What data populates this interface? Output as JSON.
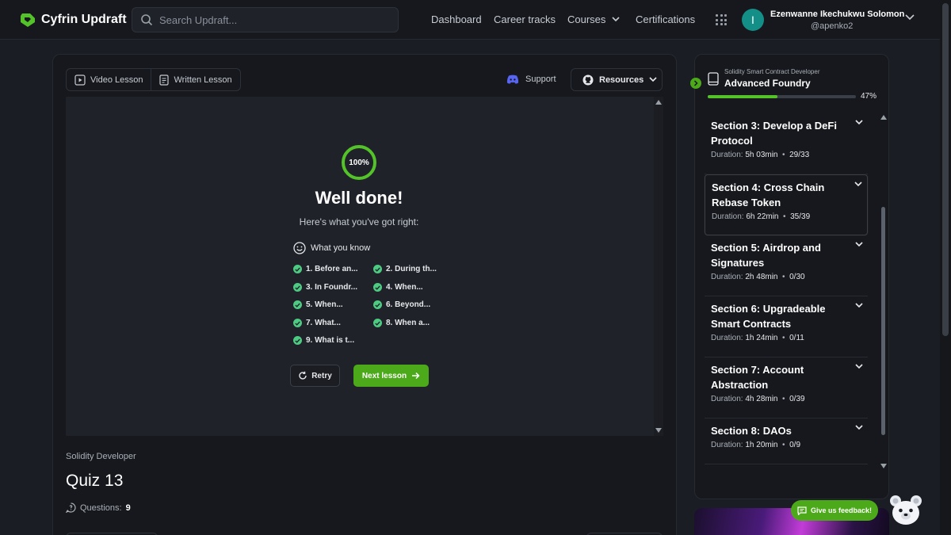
{
  "brand": {
    "name": "Cyfrin Updraft",
    "color": "#54c32a"
  },
  "search": {
    "placeholder": "Search Updraft..."
  },
  "nav": {
    "dashboard": "Dashboard",
    "career_tracks": "Career tracks",
    "courses": "Courses",
    "certifications": "Certifications"
  },
  "user": {
    "initial": "I",
    "name": "Ezenwanne Ikechukwu Solomon",
    "handle": "@apenko2"
  },
  "lesson_tabs": {
    "video": "Video Lesson",
    "written": "Written Lesson"
  },
  "support_label": "Support",
  "resources_label": "Resources",
  "quiz": {
    "score": "100%",
    "headline": "Well done!",
    "subtitle": "Here's what you've got right:",
    "know_title": "What you know",
    "answers": [
      "1. Before an...",
      "2. During th...",
      "3. In Foundr...",
      "4. When...",
      "5. When...",
      "6. Beyond...",
      "7. What...",
      "8. When a...",
      "9. What is t..."
    ],
    "retry_label": "Retry",
    "next_label": "Next lesson"
  },
  "lesson": {
    "course": "Solidity Developer",
    "title": "Quiz 13",
    "questions_label": "Questions:",
    "questions_count": "9"
  },
  "sidebar": {
    "track": "Solidity Smart Contract Developer",
    "course": "Advanced Foundry",
    "progress_percent": 47,
    "progress_label": "47%",
    "sections": [
      {
        "title": "Section 3: Develop a DeFi Protocol",
        "duration_label": "Duration:",
        "duration": "5h 03min",
        "progress": "29/33"
      },
      {
        "title": "Section 4: Cross Chain Rebase Token",
        "duration_label": "Duration:",
        "duration": "6h 22min",
        "progress": "35/39"
      },
      {
        "title": "Section 5: Airdrop and Signatures",
        "duration_label": "Duration:",
        "duration": "2h 48min",
        "progress": "0/30"
      },
      {
        "title": "Section 6: Upgradeable Smart Contracts",
        "duration_label": "Duration:",
        "duration": "1h 24min",
        "progress": "0/11"
      },
      {
        "title": "Section 7: Account Abstraction",
        "duration_label": "Duration:",
        "duration": "4h 28min",
        "progress": "0/39"
      },
      {
        "title": "Section 8: DAOs",
        "duration_label": "Duration:",
        "duration": "1h 20min",
        "progress": "0/9"
      }
    ]
  },
  "feedback_label": "Give us feedback!"
}
